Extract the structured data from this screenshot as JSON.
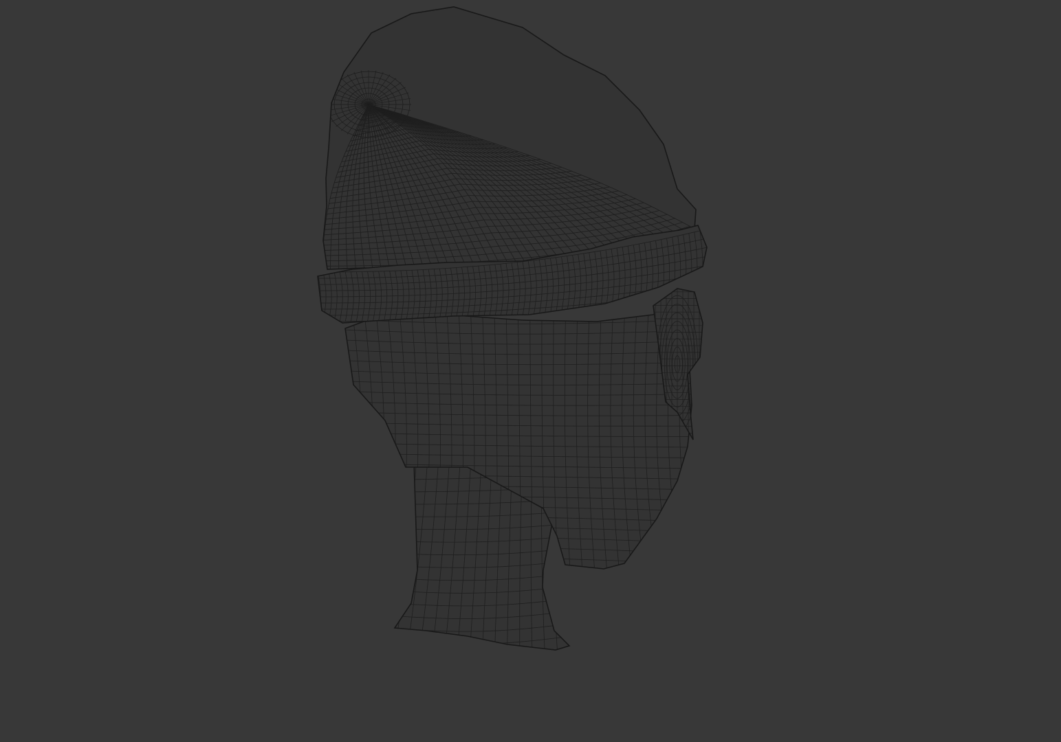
{
  "viewport": {
    "background_color": "#383838",
    "mesh_fill_color": "#333333",
    "wire_color": "#1e1e1e",
    "outline_color": "#181818",
    "display_mode": "wireframe"
  },
  "object": {
    "subject": "head-with-beanie-mesh"
  }
}
